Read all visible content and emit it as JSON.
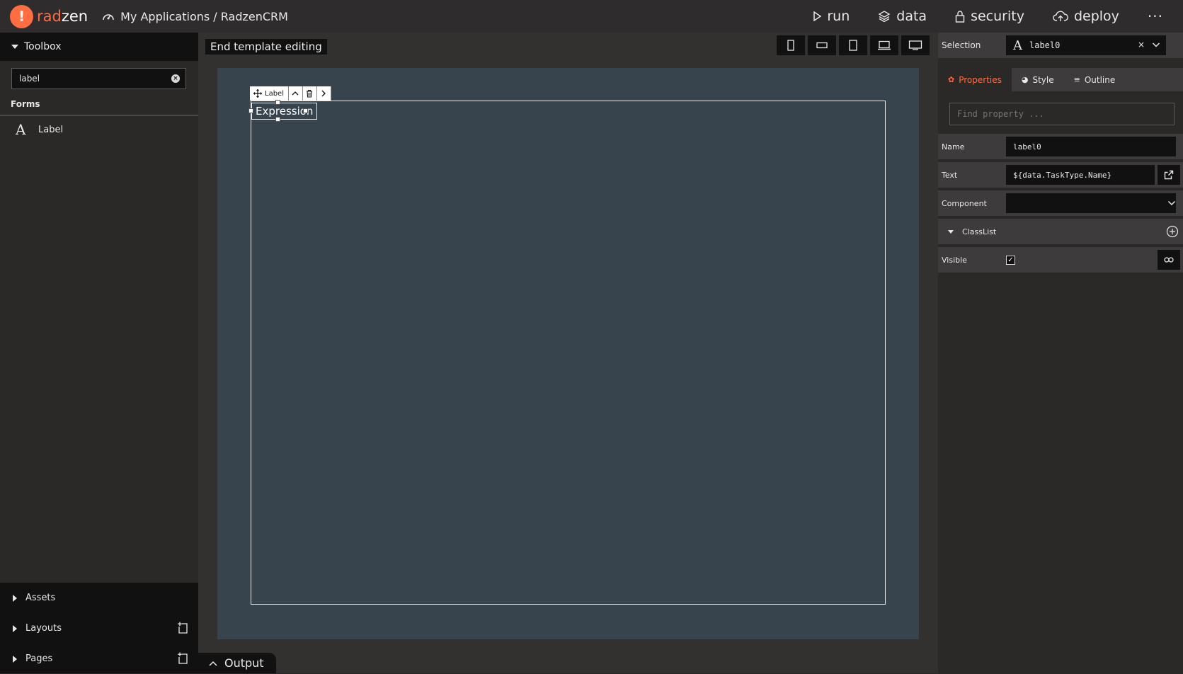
{
  "app": {
    "logo_glyph": "!",
    "logo_rad": "rad",
    "logo_zen": "zen",
    "breadcrumb": "My Applications / RadzenCRM"
  },
  "nav": {
    "run": "run",
    "data": "data",
    "security": "security",
    "deploy": "deploy",
    "more": "···"
  },
  "toolbox": {
    "title": "Toolbox",
    "search_value": "label",
    "section": "Forms",
    "items": [
      {
        "icon": "A",
        "label": "Label"
      }
    ]
  },
  "left_bottom": {
    "assets": "Assets",
    "layouts": "Layouts",
    "pages": "Pages"
  },
  "canvas": {
    "end_template": "End template editing",
    "selected_component_type": "Label",
    "selected_label_text": "Expression",
    "output": "Output"
  },
  "right": {
    "selection_label": "Selection",
    "selection_icon": "A",
    "selection_value": "label0",
    "selection_clear": "×",
    "tabs": {
      "properties": "Properties",
      "style": "Style",
      "outline": "Outline"
    },
    "find_placeholder": "Find property ...",
    "props": {
      "name_label": "Name",
      "name_value": "label0",
      "text_label": "Text",
      "text_value": "${data.TaskType.Name}",
      "component_label": "Component",
      "component_value": "",
      "classlist_label": "ClassList",
      "visible_label": "Visible",
      "visible_check": "✓"
    }
  },
  "colors": {
    "accent": "#ff6d41",
    "stage": "#37444d",
    "panel": "#3d3b3b",
    "dark": "#121111"
  }
}
